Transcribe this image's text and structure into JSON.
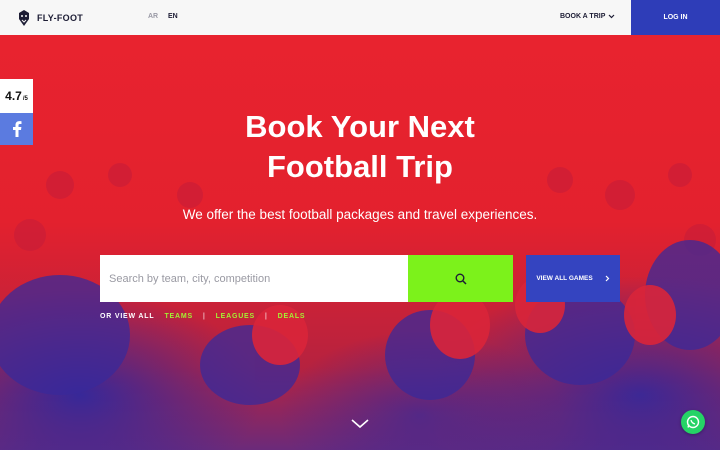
{
  "header": {
    "logo_text": "FLY-FOOT",
    "lang_ar": "AR",
    "lang_en": "EN",
    "book_trip": "BOOK A TRIP",
    "login": "LOG IN"
  },
  "hero": {
    "title_line1": "Book Your Next",
    "title_line2": "Football Trip",
    "subtitle": "We offer the best football packages and travel experiences.",
    "search_placeholder": "Search by team, city, competition",
    "view_all": "VIEW ALL GAMES",
    "or_view_all": "OR VIEW ALL",
    "links": [
      "TEAMS",
      "LEAGUES",
      "DEALS"
    ],
    "separator": "|"
  },
  "side": {
    "rating": "4.7",
    "rating_scale": "/5",
    "facebook_icon": "facebook-icon"
  },
  "colors": {
    "hero_red": "#e8232f",
    "accent_green": "#7cf21b",
    "accent_blue": "#3444c0",
    "link_green": "#a4f033",
    "header_bg": "#f7f7f7"
  }
}
